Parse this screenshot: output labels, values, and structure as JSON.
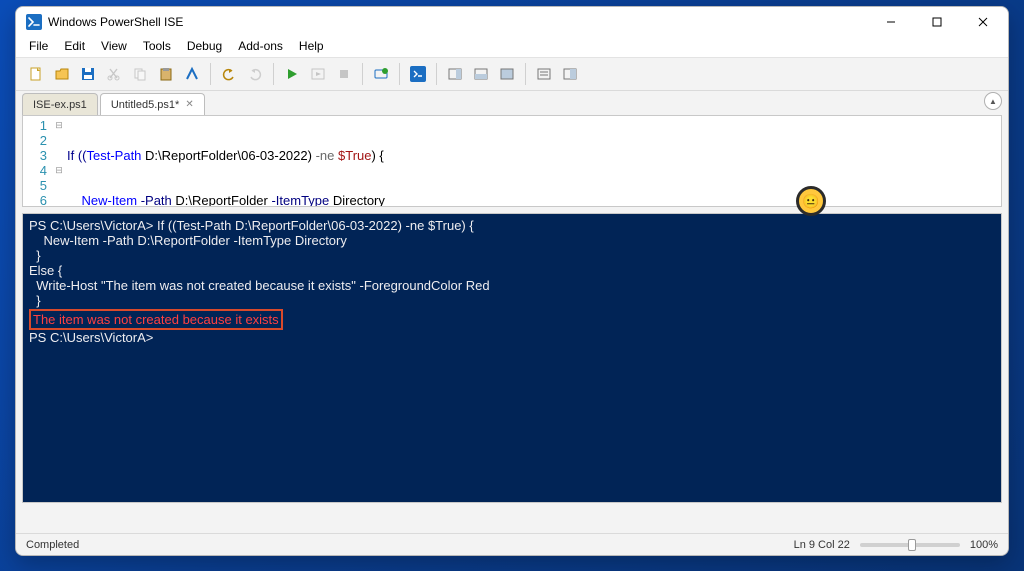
{
  "titlebar": {
    "title": "Windows PowerShell ISE"
  },
  "menus": [
    "File",
    "Edit",
    "View",
    "Tools",
    "Debug",
    "Add-ons",
    "Help"
  ],
  "tabs": [
    {
      "label": "ISE-ex.ps1",
      "active": false,
      "closable": false
    },
    {
      "label": "Untitled5.ps1*",
      "active": true,
      "closable": true
    }
  ],
  "gutter": [
    "1",
    "2",
    "3",
    "4",
    "5",
    "6"
  ],
  "code": {
    "l1_if": "If ((",
    "l1_cmd": "Test-Path",
    "l1_path": " D:\\ReportFolder\\06-03-2022",
    "l1_close": ") ",
    "l1_op": "-ne",
    "l1_sp": " ",
    "l1_true": "$True",
    "l1_brace": ") {",
    "l2_indent": "    ",
    "l2_cmd": "New-Item",
    "l2_p1": " -Path",
    "l2_v1": " D:\\ReportFolder ",
    "l2_p2": "-ItemType",
    "l2_v2": " Directory",
    "l3": "  }",
    "l4_else": "Else {",
    "l5_indent": "  ",
    "l5_cmd": "Write-Host",
    "l5_str": " \"The item was not created because it exists\" ",
    "l5_p": "-ForegroundColor",
    "l5_v": " Red",
    "l6": "  }"
  },
  "console": {
    "l1": "PS C:\\Users\\VictorA> If ((Test-Path D:\\ReportFolder\\06-03-2022) -ne $True) {",
    "l2": "    New-Item -Path D:\\ReportFolder -ItemType Directory",
    "l3": "  }",
    "l4": "Else {",
    "l5": "  Write-Host \"The item was not created because it exists\" -ForegroundColor Red",
    "l6": "  }",
    "out": "The item was not created because it exists",
    "blank": "",
    "prompt": "PS C:\\Users\\VictorA> "
  },
  "status": {
    "left": "Completed",
    "pos": "Ln 9  Col 22",
    "zoom": "100%"
  },
  "emoji": "😐"
}
